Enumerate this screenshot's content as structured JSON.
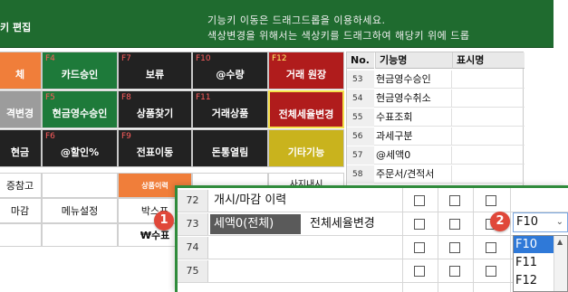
{
  "header": {
    "title": "키 편집",
    "hint_line1": "기능키 이동은 드래그드롭을 이용하세요.",
    "hint_line2": "색상변경을 위해서는 색상키를 드래그하여 해당키 위에 드롭"
  },
  "function_keys": [
    {
      "fkey": "",
      "label": "체",
      "color": "#f07e3a"
    },
    {
      "fkey": "F4",
      "label": "카드승인",
      "color": "#1e7a3a"
    },
    {
      "fkey": "F7",
      "label": "보류",
      "color": "#222222"
    },
    {
      "fkey": "F10",
      "label": "@수량",
      "color": "#222222"
    },
    {
      "fkey": "F12",
      "label": "거래 원장",
      "color": "#b01c1c"
    },
    {
      "fkey": "",
      "label": "격변경",
      "color": "#9c9c9c"
    },
    {
      "fkey": "F5",
      "label": "현금영수승인",
      "color": "#1e7a3a"
    },
    {
      "fkey": "F8",
      "label": "상품찾기",
      "color": "#222222"
    },
    {
      "fkey": "F11",
      "label": "거래상품",
      "color": "#222222"
    },
    {
      "fkey": "",
      "label": "전체세율변경",
      "color": "#b01c1c"
    },
    {
      "fkey": "",
      "label": "현금",
      "color": "#222222"
    },
    {
      "fkey": "F6",
      "label": "@할인%",
      "color": "#222222"
    },
    {
      "fkey": "F9",
      "label": "전표이동",
      "color": "#222222"
    },
    {
      "fkey": "",
      "label": "돈통열림",
      "color": "#222222"
    },
    {
      "fkey": "",
      "label": "기타기능",
      "color": "#c9b31d"
    }
  ],
  "bottom_left": {
    "cells": [
      "증참고",
      "",
      "상품이력",
      "",
      "마감",
      "메뉴설정",
      "박스포",
      "",
      "",
      "",
      "₩수표",
      ""
    ],
    "partial_text": "사지내시"
  },
  "key_list": {
    "headers": [
      "No.",
      "기능명",
      "표시명"
    ],
    "rows": [
      {
        "no": "53",
        "name": "현금영수승인"
      },
      {
        "no": "54",
        "name": "현금영수취소"
      },
      {
        "no": "55",
        "name": "수표조회"
      },
      {
        "no": "56",
        "name": "과세구분"
      },
      {
        "no": "57",
        "name": "@세액0"
      },
      {
        "no": "58",
        "name": "주문서/견적서"
      }
    ]
  },
  "zoom_panel": {
    "rows": [
      {
        "no": "72",
        "name": "개시/마감 이력",
        "desc": "",
        "selected": false
      },
      {
        "no": "73",
        "name": "세액0(전체)",
        "desc": "전체세율변경",
        "selected": true
      },
      {
        "no": "74",
        "name": "",
        "desc": "",
        "selected": false
      },
      {
        "no": "75",
        "name": "",
        "desc": "",
        "selected": false
      }
    ],
    "dropdown_value": "F10",
    "dropdown_options": [
      "F10",
      "F11",
      "F12"
    ]
  },
  "badges": [
    "1",
    "2"
  ],
  "colors": {
    "header": "#1f6b2f",
    "panel_border": "#2f8b3b",
    "badge": "#e0483a",
    "selected_option": "#2f79d8"
  }
}
